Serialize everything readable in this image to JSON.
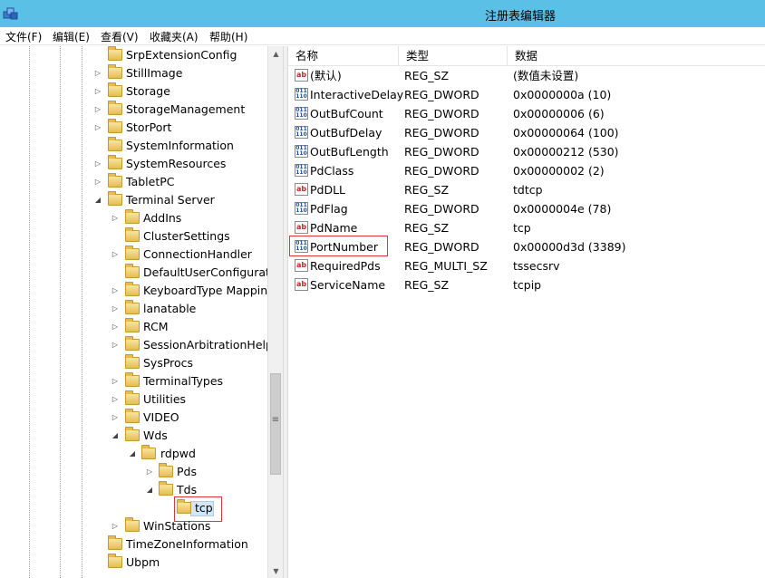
{
  "window": {
    "title": "注册表编辑器"
  },
  "menu": [
    "文件(F)",
    "编辑(E)",
    "查看(V)",
    "收藏夹(A)",
    "帮助(H)"
  ],
  "tree": {
    "items": [
      {
        "label": "SrpExtensionConfig",
        "expander": ""
      },
      {
        "label": "StillImage",
        "expander": "▷"
      },
      {
        "label": "Storage",
        "expander": "▷"
      },
      {
        "label": "StorageManagement",
        "expander": "▷"
      },
      {
        "label": "StorPort",
        "expander": "▷"
      },
      {
        "label": "SystemInformation",
        "expander": ""
      },
      {
        "label": "SystemResources",
        "expander": "▷"
      },
      {
        "label": "TabletPC",
        "expander": "▷"
      },
      {
        "label": "Terminal Server",
        "expander": "◢"
      },
      {
        "label": "AddIns",
        "expander": "▷"
      },
      {
        "label": "ClusterSettings",
        "expander": ""
      },
      {
        "label": "ConnectionHandler",
        "expander": "▷"
      },
      {
        "label": "DefaultUserConfiguratic",
        "expander": ""
      },
      {
        "label": "KeyboardType Mapping",
        "expander": "▷"
      },
      {
        "label": "lanatable",
        "expander": "▷"
      },
      {
        "label": "RCM",
        "expander": "▷"
      },
      {
        "label": "SessionArbitrationHelpe",
        "expander": "▷"
      },
      {
        "label": "SysProcs",
        "expander": ""
      },
      {
        "label": "TerminalTypes",
        "expander": "▷"
      },
      {
        "label": "Utilities",
        "expander": "▷"
      },
      {
        "label": "VIDEO",
        "expander": "▷"
      },
      {
        "label": "Wds",
        "expander": "◢"
      },
      {
        "label": "rdpwd",
        "expander": "◢"
      },
      {
        "label": "Pds",
        "expander": "▷"
      },
      {
        "label": "Tds",
        "expander": "◢"
      },
      {
        "label": "tcp",
        "expander": ""
      },
      {
        "label": "WinStations",
        "expander": "▷"
      },
      {
        "label": "TimeZoneInformation",
        "expander": ""
      },
      {
        "label": "Ubpm",
        "expander": ""
      }
    ]
  },
  "list": {
    "headers": {
      "name": "名称",
      "type": "类型",
      "data": "数据"
    },
    "rows": [
      {
        "icon": "ab",
        "name": "(默认)",
        "type": "REG_SZ",
        "data": "(数值未设置)"
      },
      {
        "icon": "dword",
        "name": "InteractiveDelay",
        "type": "REG_DWORD",
        "data": "0x0000000a (10)"
      },
      {
        "icon": "dword",
        "name": "OutBufCount",
        "type": "REG_DWORD",
        "data": "0x00000006 (6)"
      },
      {
        "icon": "dword",
        "name": "OutBufDelay",
        "type": "REG_DWORD",
        "data": "0x00000064 (100)"
      },
      {
        "icon": "dword",
        "name": "OutBufLength",
        "type": "REG_DWORD",
        "data": "0x00000212 (530)"
      },
      {
        "icon": "dword",
        "name": "PdClass",
        "type": "REG_DWORD",
        "data": "0x00000002 (2)"
      },
      {
        "icon": "ab",
        "name": "PdDLL",
        "type": "REG_SZ",
        "data": "tdtcp"
      },
      {
        "icon": "dword",
        "name": "PdFlag",
        "type": "REG_DWORD",
        "data": "0x0000004e (78)"
      },
      {
        "icon": "ab",
        "name": "PdName",
        "type": "REG_SZ",
        "data": "tcp"
      },
      {
        "icon": "dword",
        "name": "PortNumber",
        "type": "REG_DWORD",
        "data": "0x00000d3d (3389)"
      },
      {
        "icon": "ab",
        "name": "RequiredPds",
        "type": "REG_MULTI_SZ",
        "data": "tssecsrv"
      },
      {
        "icon": "ab",
        "name": "ServiceName",
        "type": "REG_SZ",
        "data": "tcpip"
      }
    ]
  },
  "icons": {
    "app": "registry-editor-icon",
    "string_value": "ab",
    "dword_value": "011 110"
  },
  "colors": {
    "titlebar": "#5bc0e6",
    "highlight_border": "#d9373b",
    "selection": "#cde8ff"
  }
}
